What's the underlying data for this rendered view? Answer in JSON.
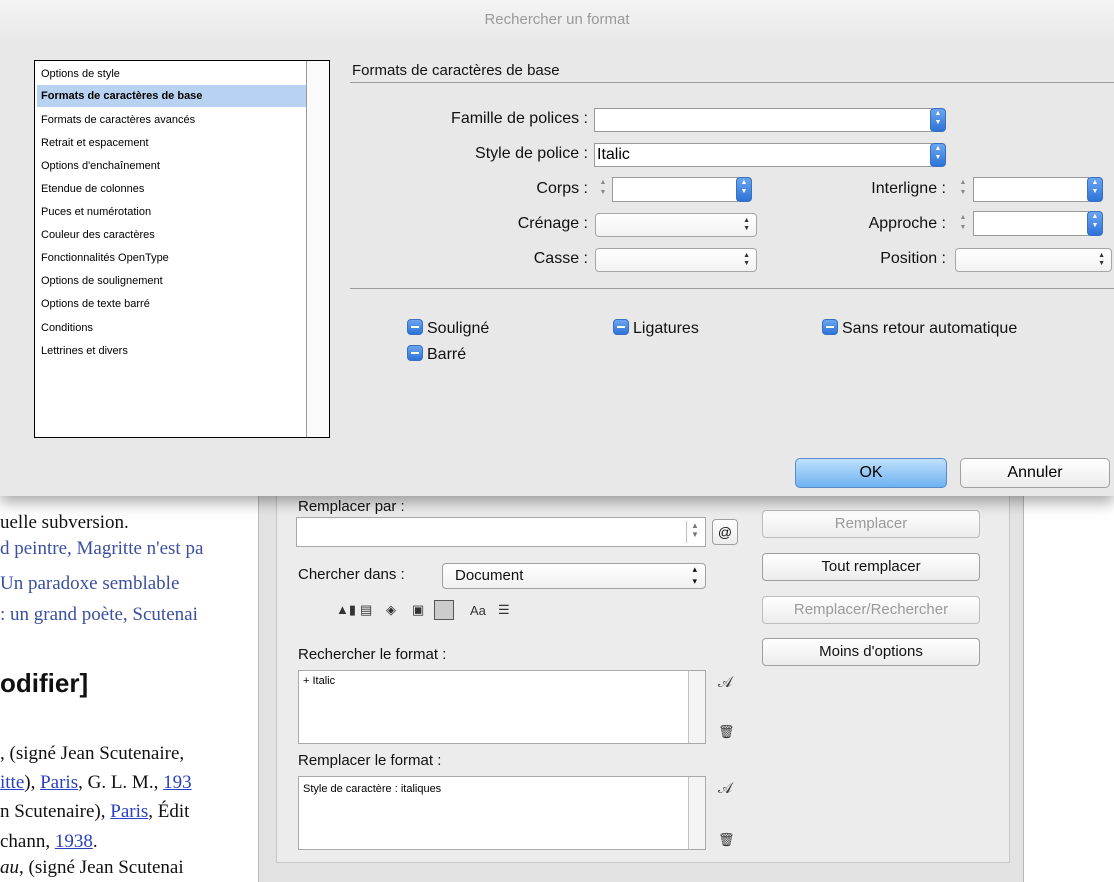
{
  "doc": {
    "lines": [
      "uelle subversion.",
      "d peintre, Magritte n'est pa",
      "Un  paradoxe  semblable",
      ": un grand poète, Scutenai"
    ],
    "heading": "odifier]",
    "biblio": {
      "l1a": ", (signé Jean Scutenaire,",
      "l2a": "itte",
      "l2b": "), ",
      "l2c": "Paris",
      "l2d": ", G. L. M., ",
      "l2e": "193",
      "l3a": "n Scutenaire), ",
      "l3b": "Paris",
      "l3c": ", Édit",
      "l4a": "chann, ",
      "l4b": "1938",
      "l4c": ".",
      "l5a": "au",
      "l5b": ", (signé Jean Scutenai"
    }
  },
  "panel": {
    "replace_with_label": "Remplacer par :",
    "replace_btn": "Remplacer",
    "replace_all_btn": "Tout remplacer",
    "replace_find_btn": "Remplacer/Rechercher",
    "fewer_options_btn": "Moins d'options",
    "search_in_label": "Chercher dans :",
    "search_in_value": "Document",
    "find_format_label": "Rechercher le format :",
    "find_format_value": "+ Italic",
    "change_format_label": "Remplacer le format :",
    "change_format_value": "Style de caractère : italiques",
    "case_icon": "Aa"
  },
  "dialog": {
    "title": "Rechercher un format",
    "categories": [
      "Options de style",
      "Formats de caractères de base",
      "Formats de caractères avancés",
      "Retrait et espacement",
      "Options d'enchaînement",
      "Etendue de colonnes",
      "Puces et numérotation",
      "Couleur des caractères",
      "Fonctionnalités OpenType",
      "Options de soulignement",
      "Options de texte barré",
      "Conditions",
      "Lettrines et divers"
    ],
    "selected_index": 1,
    "section_title": "Formats de caractères de base",
    "font_family_label": "Famille de polices :",
    "font_family_value": "",
    "font_style_label": "Style de police :",
    "font_style_value": "Italic",
    "size_label": "Corps :",
    "leading_label": "Interligne :",
    "kerning_label": "Crénage :",
    "tracking_label": "Approche :",
    "case_label": "Casse :",
    "position_label": "Position :",
    "underline": "Souligné",
    "ligatures": "Ligatures",
    "no_break": "Sans retour automatique",
    "strikethrough": "Barré",
    "ok": "OK",
    "cancel": "Annuler"
  }
}
